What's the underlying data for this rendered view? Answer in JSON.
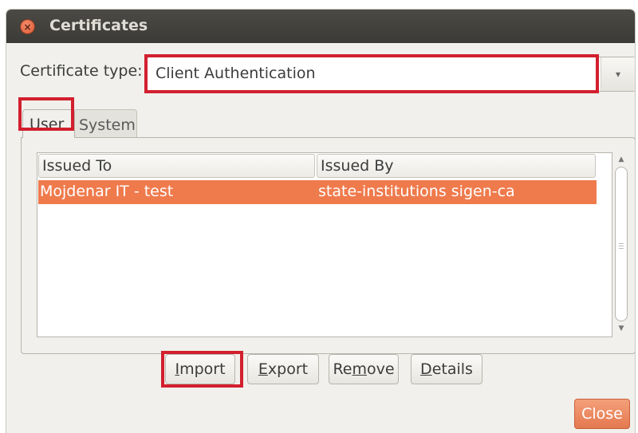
{
  "window": {
    "title": "Certificates",
    "close_glyph": "×"
  },
  "certificate_type": {
    "label": "Certificate type:",
    "value": "Client Authentication",
    "arrow_glyph": "▾"
  },
  "tabs": [
    {
      "label": "User",
      "selected": true
    },
    {
      "label": "System",
      "selected": false
    }
  ],
  "table": {
    "columns": [
      "Issued To",
      "Issued By"
    ],
    "rows": [
      {
        "issued_to": "Mojdenar IT - test",
        "issued_by": "state-institutions sigen-ca",
        "selected": true
      }
    ]
  },
  "scrollbar": {
    "up_glyph": "▲",
    "down_glyph": "▼"
  },
  "buttons": {
    "import": {
      "mnemonic": "I",
      "rest": "mport"
    },
    "export": {
      "mnemonic": "E",
      "rest": "xport"
    },
    "remove": {
      "before": "Re",
      "mnemonic": "m",
      "after": "ove"
    },
    "details": {
      "mnemonic": "D",
      "rest": "etails"
    },
    "close": "Close"
  },
  "colors": {
    "highlight_box": "#d21f2e",
    "selection": "#ef7a4c",
    "titlebar": "#3b3a36"
  }
}
